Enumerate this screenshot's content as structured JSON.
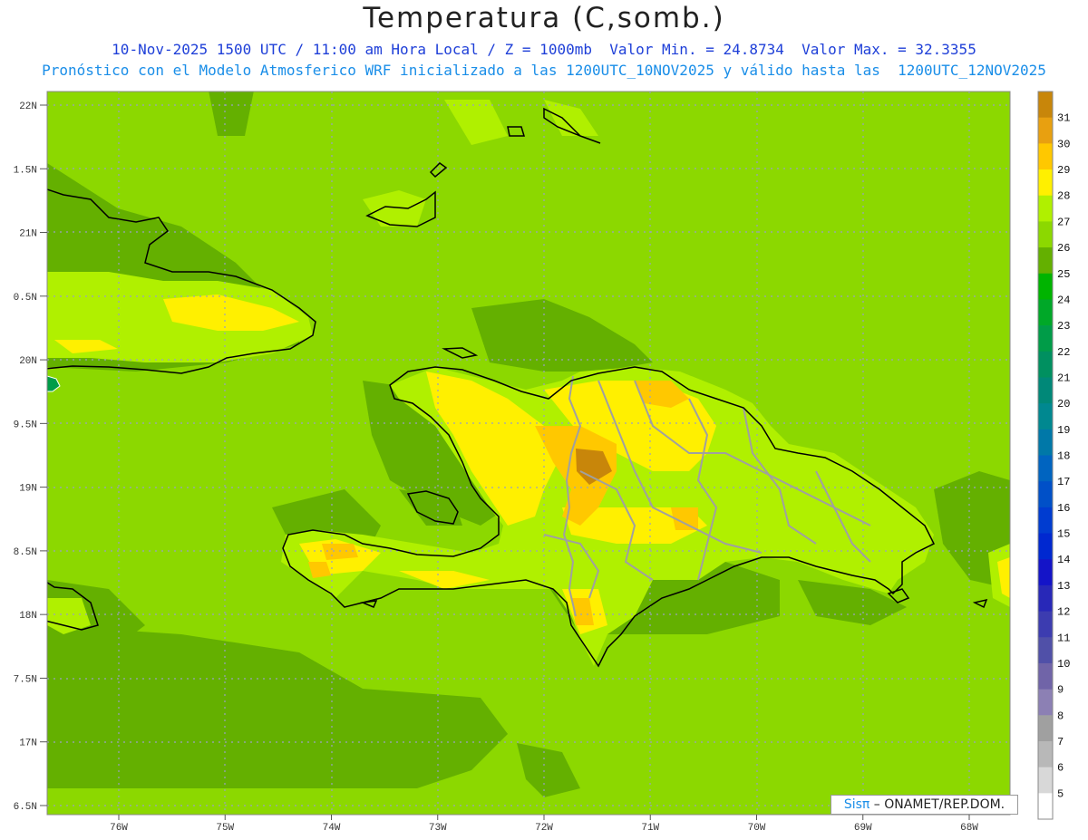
{
  "title": "Temperatura (C,somb.)",
  "subtitle_line1": "10-Nov-2025 1500 UTC / 11:00 am Hora Local / Z = 1000mb  Valor Min. = 24.8734  Valor Max. = 32.3355",
  "subtitle_line2": "Pronóstico con el Modelo Atmosferico WRF inicializado a las 1200UTC_10NOV2025 y válido hasta las  1200UTC_12NOV2025",
  "credit": {
    "brand": "Sisπ",
    "text": " – ONAMET/REP.DOM."
  },
  "lat_labels": [
    "22N",
    "1.5N",
    "21N",
    "0.5N",
    "20N",
    "9.5N",
    "19N",
    "8.5N",
    "18N",
    "7.5N",
    "17N",
    "6.5N"
  ],
  "lon_labels": [
    "76W",
    "75W",
    "74W",
    "73W",
    "72W",
    "71W",
    "70W",
    "69W",
    "68W"
  ],
  "colorbar": {
    "labels": [
      "31",
      "30",
      "29",
      "28",
      "27",
      "26",
      "25",
      "24",
      "23",
      "22",
      "21",
      "20",
      "19",
      "18",
      "17",
      "16",
      "15",
      "14",
      "13",
      "12",
      "11",
      "10",
      "9",
      "8",
      "7",
      "6",
      "5"
    ],
    "colors": [
      "#c8860a",
      "#e8a010",
      "#ffc800",
      "#fff000",
      "#b0f000",
      "#8cd800",
      "#64b000",
      "#00b400",
      "#00a828",
      "#009c48",
      "#009060",
      "#008878",
      "#008890",
      "#0078a8",
      "#0064c0",
      "#0050c8",
      "#003cd0",
      "#0028d0",
      "#1414c8",
      "#2828b8",
      "#3c3cb0",
      "#5050a8",
      "#7064a8",
      "#8c80b4",
      "#a0a0a0",
      "#b8b8b8",
      "#d8d8d8",
      "#ffffff"
    ]
  },
  "field_colors": {
    "ocean": "#8cd800",
    "cool": "#64b000",
    "warm": "#b0f000",
    "warmer": "#fff000",
    "hot": "#ffc800",
    "hotter": "#e8a010",
    "hottest": "#c8860a",
    "cold_spot": "#009c48",
    "coast": "#000000",
    "border": "#a0a0a0",
    "grid": "#9aa0c0"
  }
}
